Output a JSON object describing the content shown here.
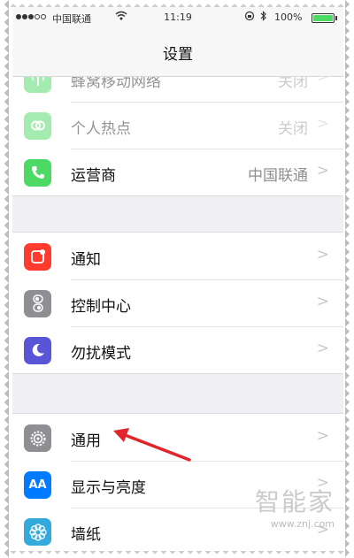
{
  "status_bar": {
    "signal_dots_filled": 3,
    "signal_dots_total": 5,
    "carrier": "中国联通",
    "time": "11:19",
    "battery_percent": "100%",
    "battery_level": 1.0
  },
  "nav": {
    "title": "设置"
  },
  "groups": [
    {
      "items": [
        {
          "label": "蜂窝移动网络",
          "value": "关闭",
          "icon": "antenna-icon",
          "color": "#4cd964"
        },
        {
          "label": "个人热点",
          "value": "关闭",
          "icon": "hotspot-chain-icon",
          "color": "#4cd964"
        },
        {
          "label": "运营商",
          "value": "中国联通",
          "icon": "phone-icon",
          "color": "#4cd964"
        }
      ]
    },
    {
      "items": [
        {
          "label": "通知",
          "value": "",
          "icon": "notification-icon",
          "color": "#ff3b30"
        },
        {
          "label": "控制中心",
          "value": "",
          "icon": "control-center-icon",
          "color": "#8e8e93"
        },
        {
          "label": "勿扰模式",
          "value": "",
          "icon": "moon-icon",
          "color": "#5856d6"
        }
      ]
    },
    {
      "items": [
        {
          "label": "通用",
          "value": "",
          "icon": "gear-icon",
          "color": "#8e8e93"
        },
        {
          "label": "显示与亮度",
          "value": "",
          "icon": "aa-icon",
          "color": "#007aff"
        },
        {
          "label": "墙纸",
          "value": "",
          "icon": "flower-icon",
          "color": "#34aadc"
        }
      ]
    }
  ],
  "annotation": {
    "arrow_color": "#e0262b"
  },
  "watermark": {
    "logo": "智能家",
    "url": "www.znj.com"
  }
}
